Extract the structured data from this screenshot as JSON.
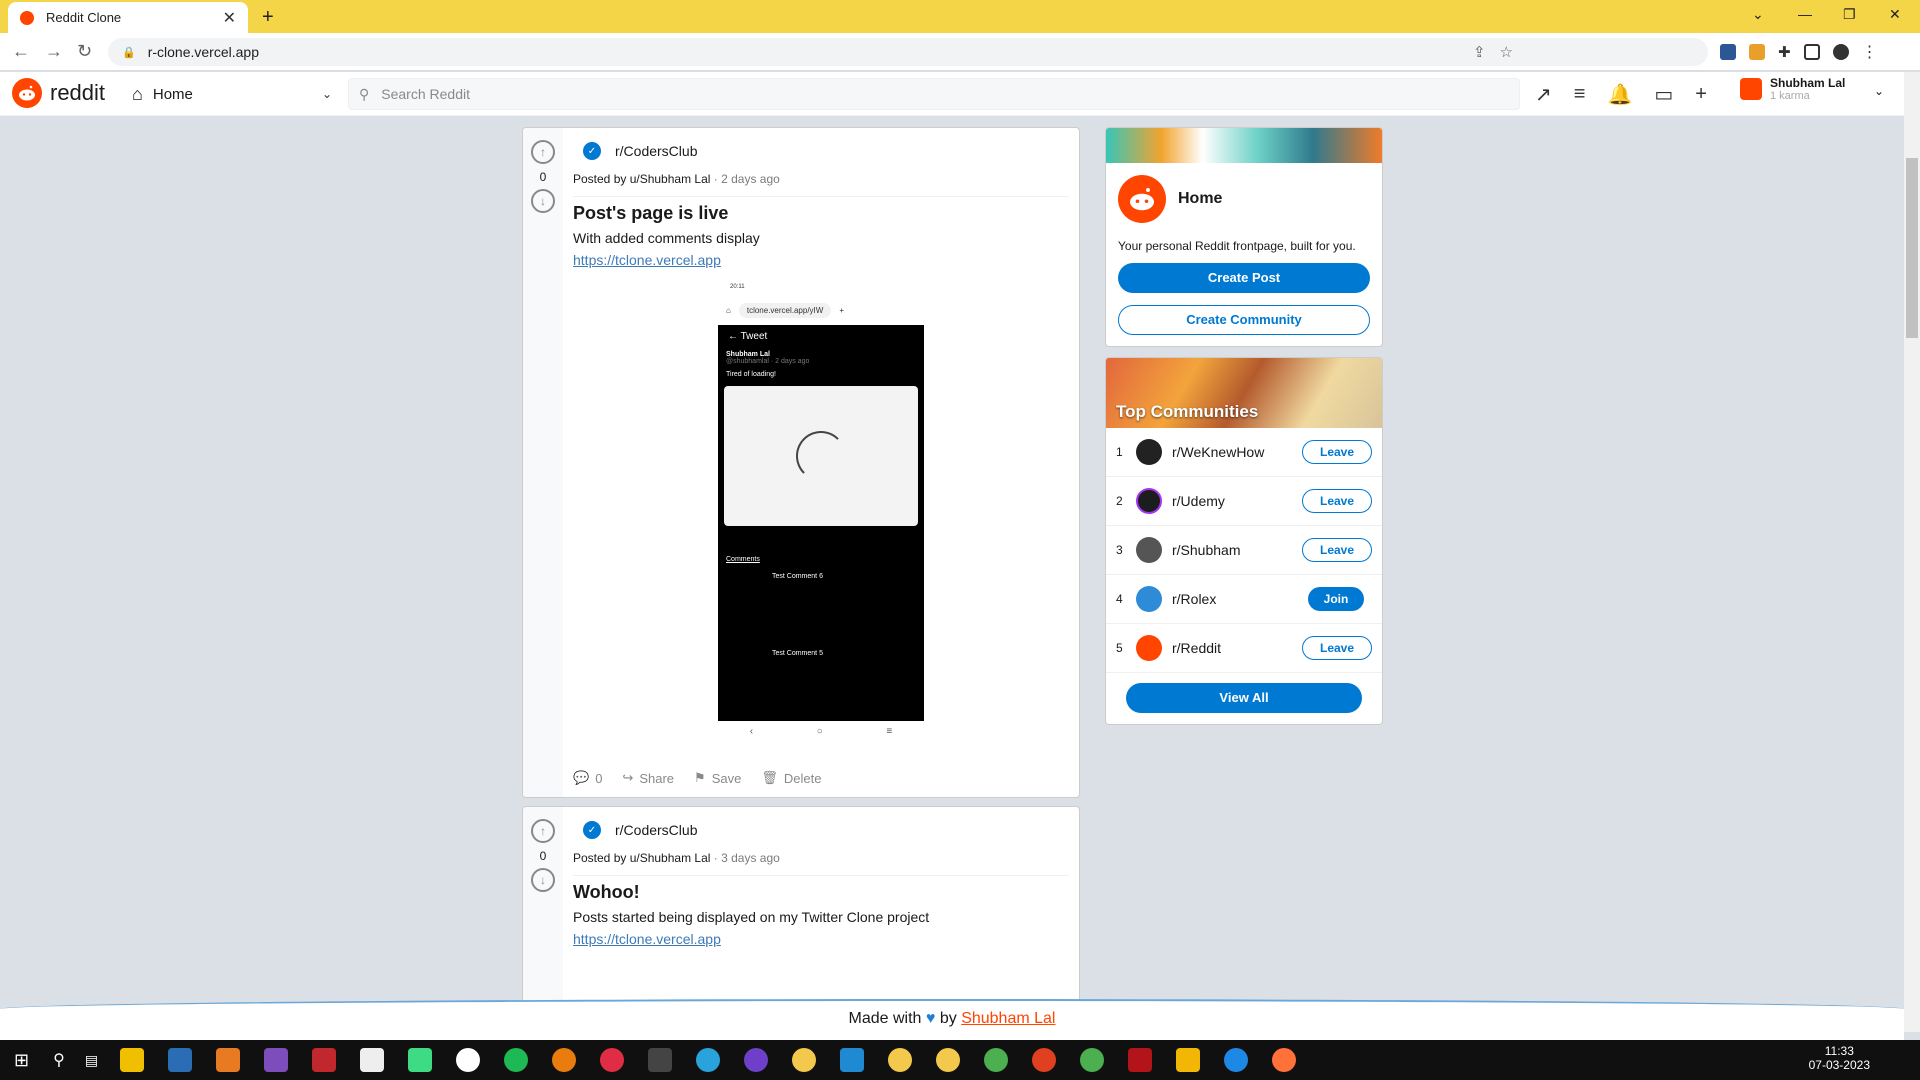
{
  "browser": {
    "tab_title": "Reddit Clone",
    "new_tab": "+",
    "url": "r-clone.vercel.app"
  },
  "header": {
    "logo_text": "reddit",
    "home_label": "Home",
    "search_placeholder": "Search Reddit",
    "user_name": "Shubham Lal",
    "user_karma": "1 karma"
  },
  "posts": [
    {
      "subreddit": "r/CodersClub",
      "posted_by": "Posted by u/Shubham Lal",
      "time": " · 2 days ago",
      "votes": "0",
      "title": "Post's page is live",
      "body": "With added comments display",
      "link": "https://tclone.vercel.app",
      "comments": "0",
      "share": "Share",
      "save": "Save",
      "delete": "Delete",
      "phone": {
        "time": "20:11",
        "url": "tclone.vercel.app/yIW",
        "header": "Tweet",
        "author": "Shubham Lal",
        "handle": "@shubhamlal · 2 days ago",
        "text": "Tired of loading!",
        "comments_label": "Comments",
        "comment1": "Test Comment 6",
        "comment2": "Test Comment 5"
      }
    },
    {
      "subreddit": "r/CodersClub",
      "posted_by": "Posted by u/Shubham Lal",
      "time": " · 3 days ago",
      "votes": "0",
      "title": "Wohoo!",
      "body": "Posts started being displayed on my Twitter Clone project",
      "link": "https://tclone.vercel.app"
    }
  ],
  "sidebar": {
    "home_title": "Home",
    "home_desc": "Your personal Reddit frontpage, built for you.",
    "create_post": "Create Post",
    "create_community": "Create Community",
    "top_title": "Top Communities",
    "communities": [
      {
        "rank": "1",
        "name": "r/WeKnewHow",
        "action": "Leave"
      },
      {
        "rank": "2",
        "name": "r/Udemy",
        "action": "Leave"
      },
      {
        "rank": "3",
        "name": "r/Shubham",
        "action": "Leave"
      },
      {
        "rank": "4",
        "name": "r/Rolex",
        "action": "Join"
      },
      {
        "rank": "5",
        "name": "r/Reddit",
        "action": "Leave"
      }
    ],
    "view_all": "View All"
  },
  "footer": {
    "made_with": "Made with",
    "by": "by",
    "author": "Shubham Lal"
  },
  "taskbar": {
    "time": "11:33",
    "date": "07-03-2023"
  },
  "colors": {
    "reddit_orange": "#ff4500",
    "reddit_blue": "#0079d3",
    "chrome_titlebar": "#f5d548"
  }
}
